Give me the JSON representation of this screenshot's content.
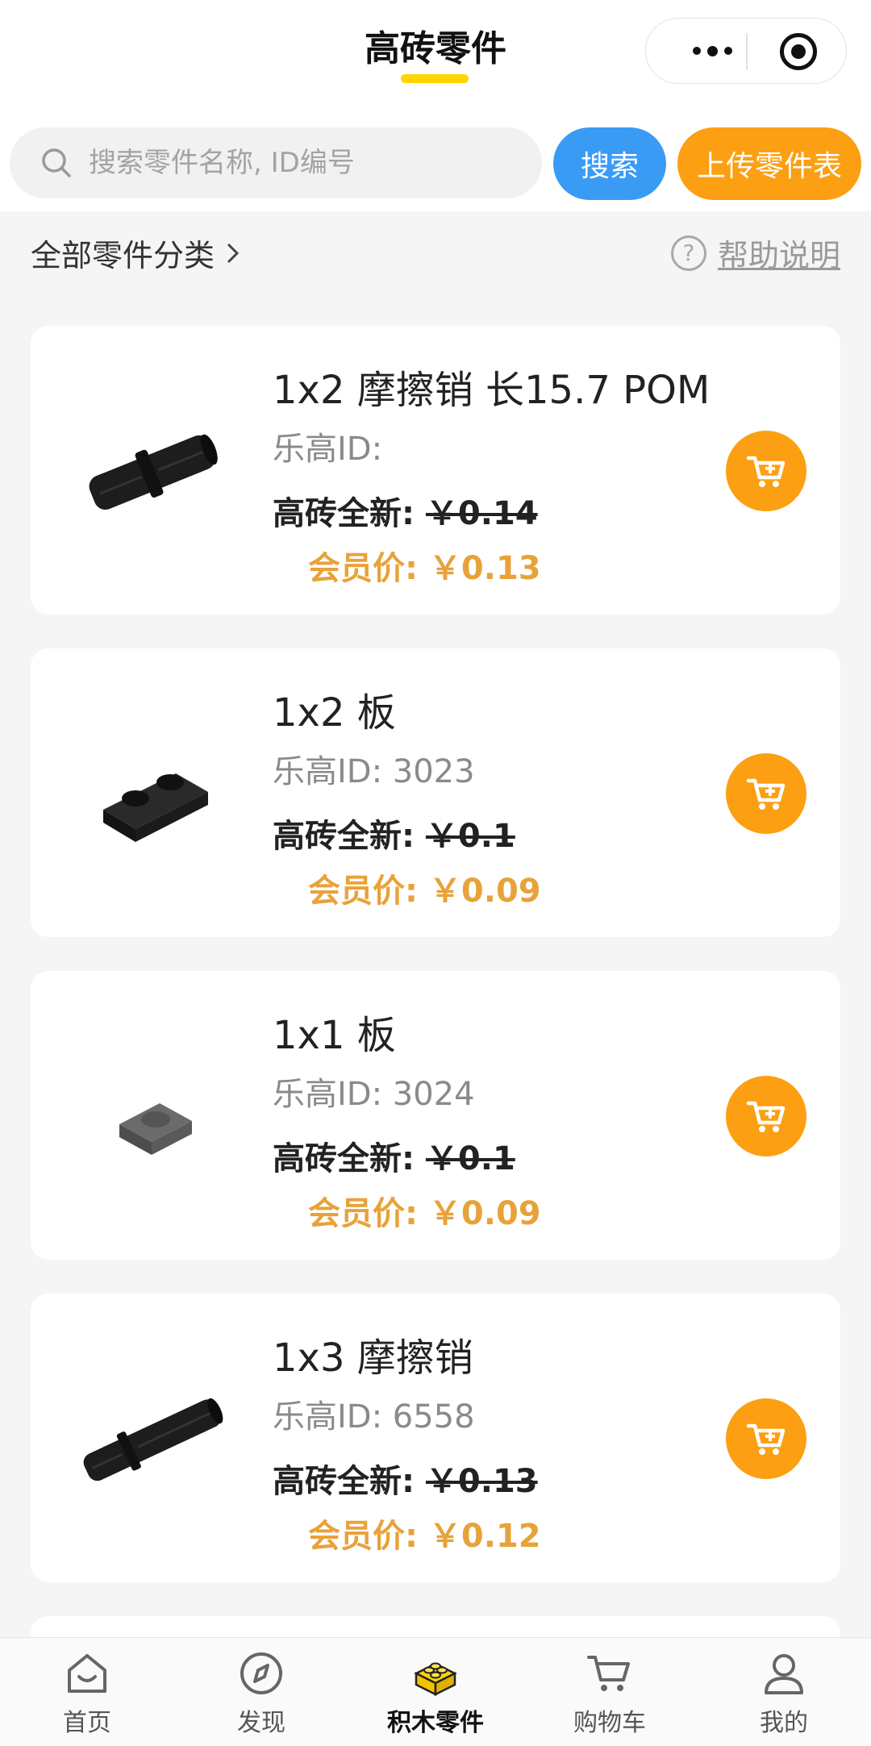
{
  "header": {
    "title": "高砖零件"
  },
  "search": {
    "placeholder": "搜索零件名称, ID编号",
    "value": "",
    "search_label": "搜索",
    "upload_label": "上传零件表"
  },
  "filter": {
    "category_label": "全部零件分类",
    "help_label": "帮助说明"
  },
  "products": [
    {
      "name": "1x2 摩擦销 长15.7 POM",
      "lego_id": "乐高ID:",
      "price_label": "高砖全新:",
      "old_price": "￥0.14",
      "member_label": "会员价:",
      "member_price": "￥0.13",
      "image": "pin-long-black"
    },
    {
      "name": "1x2 板",
      "lego_id": "乐高ID: 3023",
      "price_label": "高砖全新:",
      "old_price": "￥0.1",
      "member_label": "会员价:",
      "member_price": "￥0.09",
      "image": "plate-1x2-black"
    },
    {
      "name": "1x1 板",
      "lego_id": "乐高ID: 3024",
      "price_label": "高砖全新:",
      "old_price": "￥0.1",
      "member_label": "会员价:",
      "member_price": "￥0.09",
      "image": "plate-1x1-grey"
    },
    {
      "name": "1x3 摩擦销",
      "lego_id": "乐高ID: 6558",
      "price_label": "高砖全新:",
      "old_price": "￥0.13",
      "member_label": "会员价:",
      "member_price": "￥0.12",
      "image": "pin-3l-black"
    }
  ],
  "tabbar": {
    "items": [
      {
        "label": "首页",
        "icon": "home-icon",
        "active": false
      },
      {
        "label": "发现",
        "icon": "compass-icon",
        "active": false
      },
      {
        "label": "积木零件",
        "icon": "brick-icon",
        "active": true
      },
      {
        "label": "购物车",
        "icon": "cart-icon",
        "active": false
      },
      {
        "label": "我的",
        "icon": "user-icon",
        "active": false
      }
    ]
  },
  "colors": {
    "accent_orange": "#fd9f12",
    "accent_blue": "#3a9bf5",
    "member_price": "#e8a23a",
    "title_underline": "#ffd400"
  }
}
